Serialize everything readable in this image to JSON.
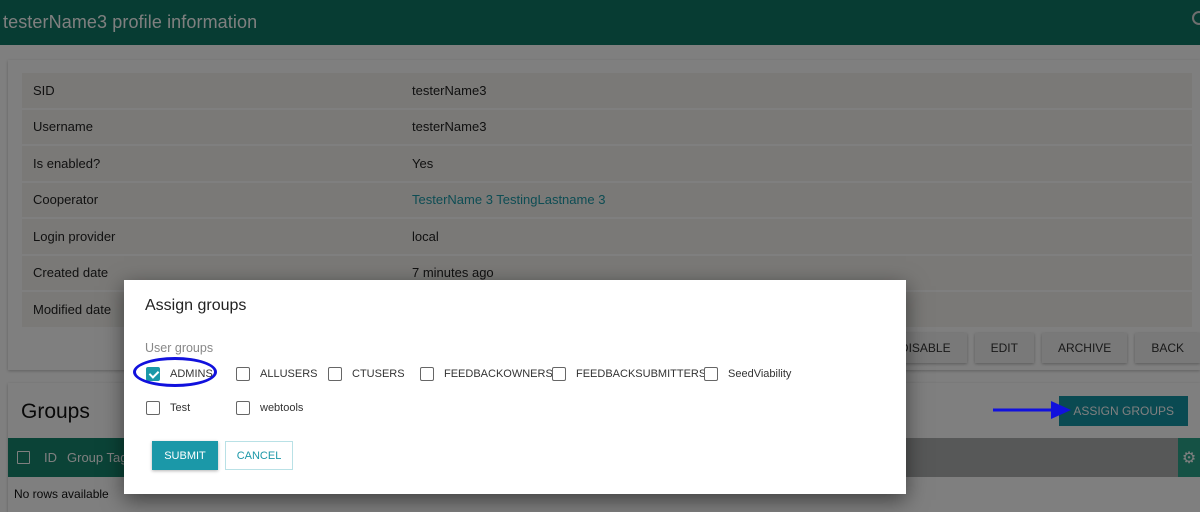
{
  "header": {
    "title": "testerName3 profile information"
  },
  "profile": {
    "rows": [
      {
        "label": "SID",
        "value": "testerName3"
      },
      {
        "label": "Username",
        "value": "testerName3"
      },
      {
        "label": "Is enabled?",
        "value": "Yes"
      },
      {
        "label": "Cooperator",
        "value": "TesterName 3 TestingLastname 3"
      },
      {
        "label": "Login provider",
        "value": "local"
      },
      {
        "label": "Created date",
        "value": "7 minutes ago"
      },
      {
        "label": "Modified date",
        "value": ""
      }
    ],
    "actions": {
      "disable": "DISABLE",
      "edit": "EDIT",
      "archive": "ARCHIVE",
      "back": "BACK"
    }
  },
  "groups": {
    "title": "Groups",
    "assign_button": "ASSIGN GROUPS",
    "grid": {
      "columns": [
        "ID",
        "Group Tag"
      ],
      "empty_text": "No rows available",
      "settings_icon": "gear-icon"
    }
  },
  "dialog": {
    "title": "Assign groups",
    "field_label": "User groups",
    "options": [
      {
        "label": "ADMINS",
        "checked": true
      },
      {
        "label": "ALLUSERS",
        "checked": false
      },
      {
        "label": "CTUSERS",
        "checked": false
      },
      {
        "label": "FEEDBACKOWNERS",
        "checked": false
      },
      {
        "label": "FEEDBACKSUBMITTERS",
        "checked": false
      },
      {
        "label": "SeedViability",
        "checked": false
      },
      {
        "label": "Test",
        "checked": false
      },
      {
        "label": "webtools",
        "checked": false
      }
    ],
    "submit": "SUBMIT",
    "cancel": "CANCEL"
  },
  "colors": {
    "header": "#0e7966",
    "accent": "#1b98a8",
    "annotation": "#1111dd"
  }
}
